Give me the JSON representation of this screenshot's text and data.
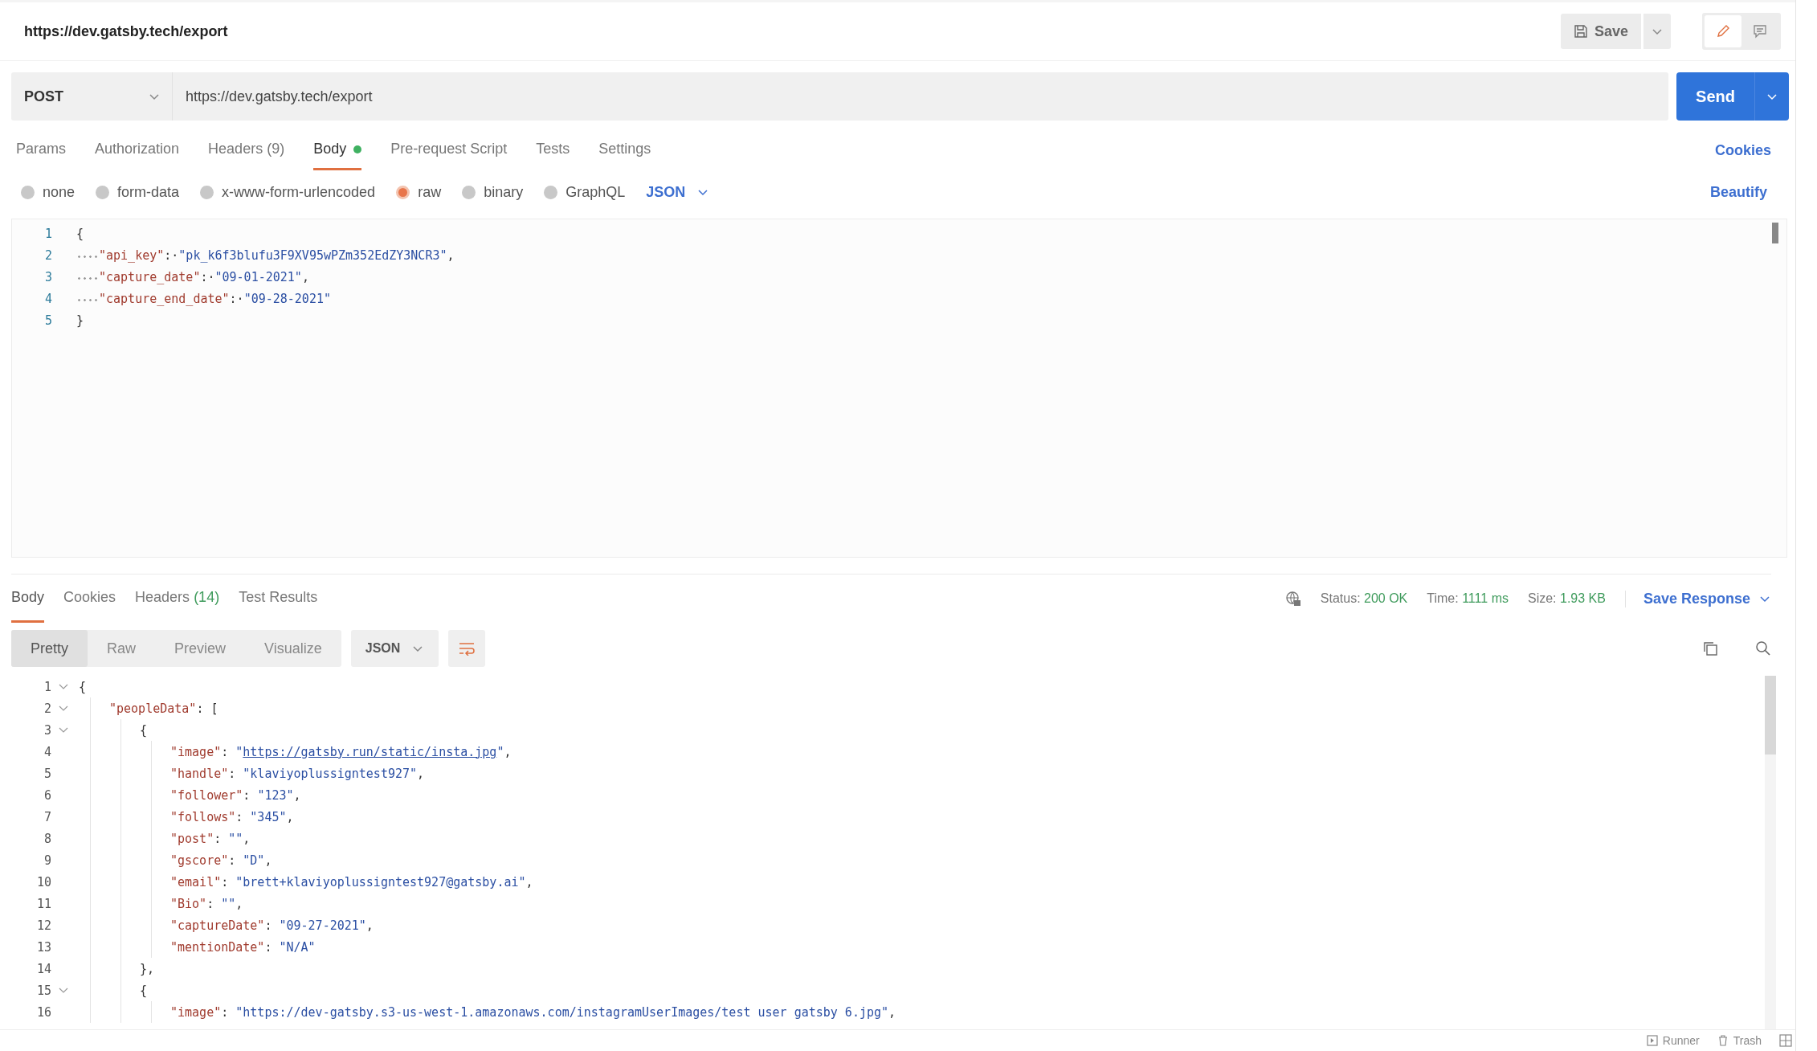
{
  "request_title": "https://dev.gatsby.tech/export",
  "save_button": "Save",
  "method": "POST",
  "url": "https://dev.gatsby.tech/export",
  "send_button": "Send",
  "request_tabs": [
    {
      "label": "Params",
      "selected": false
    },
    {
      "label": "Authorization",
      "selected": false
    },
    {
      "label": "Headers",
      "count": "(9)",
      "selected": false
    },
    {
      "label": "Body",
      "dot": true,
      "selected": true
    },
    {
      "label": "Pre-request Script",
      "selected": false
    },
    {
      "label": "Tests",
      "selected": false
    },
    {
      "label": "Settings",
      "selected": false
    }
  ],
  "cookies_link": "Cookies",
  "body_types": [
    {
      "label": "none",
      "selected": false
    },
    {
      "label": "form-data",
      "selected": false
    },
    {
      "label": "x-www-form-urlencoded",
      "selected": false
    },
    {
      "label": "raw",
      "selected": true
    },
    {
      "label": "binary",
      "selected": false
    },
    {
      "label": "GraphQL",
      "selected": false
    }
  ],
  "body_format": "JSON",
  "beautify_link": "Beautify",
  "request_body": [
    {
      "number": "1",
      "tokens": [
        {
          "kind": "punct",
          "text": "{"
        }
      ],
      "children": [
        {
          "number": "2",
          "tokens": [
            {
              "kind": "key",
              "text": "\"api_key\""
            },
            {
              "kind": "punct",
              "text": ":·"
            },
            {
              "kind": "str",
              "text": "\"pk_k6f3blufu3F9XV95wPZm352EdZY3NCR3\""
            },
            {
              "kind": "punct",
              "text": ","
            }
          ]
        },
        {
          "number": "3",
          "tokens": [
            {
              "kind": "key",
              "text": "\"capture_date\""
            },
            {
              "kind": "punct",
              "text": ":·"
            },
            {
              "kind": "str",
              "text": "\"09-01-2021\""
            },
            {
              "kind": "punct",
              "text": ","
            }
          ]
        },
        {
          "number": "4",
          "tokens": [
            {
              "kind": "key",
              "text": "\"capture_end_date\""
            },
            {
              "kind": "punct",
              "text": ":·"
            },
            {
              "kind": "str",
              "text": "\"09-28-2021\""
            }
          ]
        }
      ]
    },
    {
      "number": "5",
      "tokens": [
        {
          "kind": "punct",
          "text": "}"
        }
      ]
    }
  ],
  "response_tabs": [
    {
      "label": "Body",
      "selected": true
    },
    {
      "label": "Cookies",
      "selected": false
    },
    {
      "label": "Headers",
      "count": "(14)",
      "selected": false
    },
    {
      "label": "Test Results",
      "selected": false
    }
  ],
  "status": [
    {
      "label": "Status:",
      "value": "200 OK"
    },
    {
      "label": "Time:",
      "value": "1111 ms"
    },
    {
      "label": "Size:",
      "value": "1.93 KB"
    }
  ],
  "save_response": "Save Response",
  "view_modes": [
    {
      "label": "Pretty",
      "selected": true
    },
    {
      "label": "Raw",
      "selected": false
    },
    {
      "label": "Preview",
      "selected": false
    },
    {
      "label": "Visualize",
      "selected": false
    }
  ],
  "response_format": "JSON",
  "response_body": [
    {
      "number": "1",
      "tokens": [
        {
          "kind": "punct",
          "text": "{"
        }
      ],
      "children": [
        {
          "number": "2",
          "tokens": [
            {
              "kind": "key",
              "text": "\"peopleData\""
            },
            {
              "kind": "punct",
              "text": ": ["
            }
          ],
          "children": [
            {
              "number": "3",
              "tokens": [
                {
                  "kind": "punct",
                  "text": "{"
                }
              ],
              "children": [
                {
                  "number": "4",
                  "tokens": [
                    {
                      "kind": "key",
                      "text": "\"image\""
                    },
                    {
                      "kind": "punct",
                      "text": ": "
                    },
                    {
                      "kind": "str",
                      "text": "\""
                    },
                    {
                      "kind": "link",
                      "text": "https://gatsby.run/static/insta.jpg"
                    },
                    {
                      "kind": "str",
                      "text": "\""
                    },
                    {
                      "kind": "punct",
                      "text": ","
                    }
                  ]
                },
                {
                  "number": "5",
                  "tokens": [
                    {
                      "kind": "key",
                      "text": "\"handle\""
                    },
                    {
                      "kind": "punct",
                      "text": ": "
                    },
                    {
                      "kind": "str",
                      "text": "\"klaviyoplussigntest927\""
                    },
                    {
                      "kind": "punct",
                      "text": ","
                    }
                  ]
                },
                {
                  "number": "6",
                  "tokens": [
                    {
                      "kind": "key",
                      "text": "\"follower\""
                    },
                    {
                      "kind": "punct",
                      "text": ": "
                    },
                    {
                      "kind": "str",
                      "text": "\"123\""
                    },
                    {
                      "kind": "punct",
                      "text": ","
                    }
                  ]
                },
                {
                  "number": "7",
                  "tokens": [
                    {
                      "kind": "key",
                      "text": "\"follows\""
                    },
                    {
                      "kind": "punct",
                      "text": ": "
                    },
                    {
                      "kind": "str",
                      "text": "\"345\""
                    },
                    {
                      "kind": "punct",
                      "text": ","
                    }
                  ]
                },
                {
                  "number": "8",
                  "tokens": [
                    {
                      "kind": "key",
                      "text": "\"post\""
                    },
                    {
                      "kind": "punct",
                      "text": ": "
                    },
                    {
                      "kind": "str",
                      "text": "\"\""
                    },
                    {
                      "kind": "punct",
                      "text": ","
                    }
                  ]
                },
                {
                  "number": "9",
                  "tokens": [
                    {
                      "kind": "key",
                      "text": "\"gscore\""
                    },
                    {
                      "kind": "punct",
                      "text": ": "
                    },
                    {
                      "kind": "str",
                      "text": "\"D\""
                    },
                    {
                      "kind": "punct",
                      "text": ","
                    }
                  ]
                },
                {
                  "number": "10",
                  "tokens": [
                    {
                      "kind": "key",
                      "text": "\"email\""
                    },
                    {
                      "kind": "punct",
                      "text": ": "
                    },
                    {
                      "kind": "str",
                      "text": "\"brett+klaviyoplussigntest927@gatsby.ai\""
                    },
                    {
                      "kind": "punct",
                      "text": ","
                    }
                  ]
                },
                {
                  "number": "11",
                  "tokens": [
                    {
                      "kind": "key",
                      "text": "\"Bio\""
                    },
                    {
                      "kind": "punct",
                      "text": ": "
                    },
                    {
                      "kind": "str",
                      "text": "\"\""
                    },
                    {
                      "kind": "punct",
                      "text": ","
                    }
                  ]
                },
                {
                  "number": "12",
                  "tokens": [
                    {
                      "kind": "key",
                      "text": "\"captureDate\""
                    },
                    {
                      "kind": "punct",
                      "text": ": "
                    },
                    {
                      "kind": "str",
                      "text": "\"09-27-2021\""
                    },
                    {
                      "kind": "punct",
                      "text": ","
                    }
                  ]
                },
                {
                  "number": "13",
                  "tokens": [
                    {
                      "kind": "key",
                      "text": "\"mentionDate\""
                    },
                    {
                      "kind": "punct",
                      "text": ": "
                    },
                    {
                      "kind": "str",
                      "text": "\"N/A\""
                    }
                  ]
                }
              ]
            },
            {
              "number": "14",
              "tokens": [
                {
                  "kind": "punct",
                  "text": "},"
                }
              ]
            },
            {
              "number": "15",
              "tokens": [
                {
                  "kind": "punct",
                  "text": "{"
                }
              ],
              "children": [
                {
                  "number": "16",
                  "tokens": [
                    {
                      "kind": "key",
                      "text": "\"image\""
                    },
                    {
                      "kind": "punct",
                      "text": ": "
                    },
                    {
                      "kind": "str",
                      "text": "\"https://dev-gatsby.s3-us-west-1.amazonaws.com/instagramUserImages/test user gatsby 6.jpg\""
                    },
                    {
                      "kind": "punct",
                      "text": ","
                    }
                  ]
                }
              ]
            }
          ]
        }
      ]
    }
  ],
  "footer": [
    {
      "kind": "runner",
      "label": "Runner"
    },
    {
      "kind": "trash",
      "label": "Trash"
    }
  ]
}
